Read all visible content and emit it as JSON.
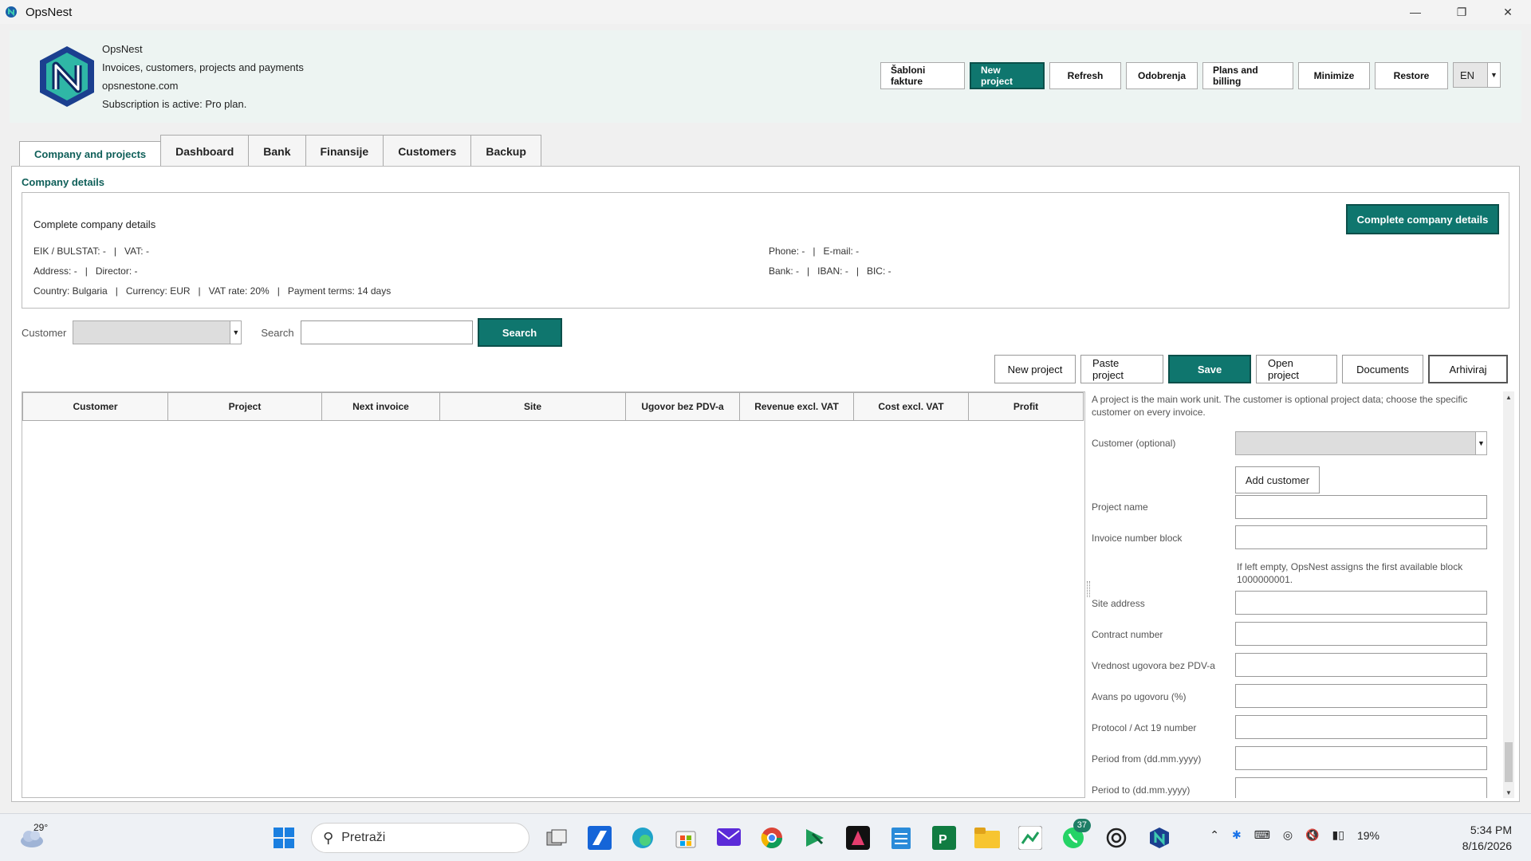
{
  "window": {
    "title": "OpsNest"
  },
  "header": {
    "app_name": "OpsNest",
    "tagline": "Invoices, customers, projects and payments",
    "website": "opsnestone.com",
    "subscription": "Subscription is active: Pro plan.",
    "buttons": [
      "Šabloni fakture",
      "New project",
      "Refresh",
      "Odobrenja",
      "Plans and billing",
      "Minimize",
      "Restore"
    ],
    "language": "EN"
  },
  "tabs": [
    "Company and projects",
    "Dashboard",
    "Bank",
    "Finansije",
    "Customers",
    "Backup"
  ],
  "company": {
    "section_title": "Company details",
    "box_label": "Complete company details",
    "complete_button": "Complete company details",
    "eik": "EIK / BULSTAT: -",
    "vat": "VAT: -",
    "address": "Address: -",
    "director": "Director: -",
    "country": "Country: Bulgaria",
    "currency": "Currency: EUR",
    "vat_rate": "VAT rate: 20%",
    "payment_terms": "Payment terms: 14 days",
    "phone": "Phone: -",
    "email": "E-mail: -",
    "bank": "Bank: -",
    "iban": "IBAN: -",
    "bic": "BIC: -"
  },
  "filter": {
    "customer_label": "Customer",
    "search_label": "Search",
    "search_button": "Search"
  },
  "actions": [
    "New project",
    "Paste project",
    "Save",
    "Open project",
    "Documents",
    "Arhiviraj"
  ],
  "table": {
    "columns": [
      "Customer",
      "Project",
      "Next invoice",
      "Site",
      "Ugovor bez PDV-a",
      "Revenue excl. VAT",
      "Cost excl. VAT",
      "Profit"
    ]
  },
  "form": {
    "intro": "A project is the main work unit. The customer is optional project data; choose the specific customer on every invoice.",
    "customer_label": "Customer (optional)",
    "add_customer": "Add customer",
    "project_name": "Project name",
    "invoice_block": "Invoice number block",
    "invoice_hint": "If left empty, OpsNest assigns the first available block 1000000001.",
    "site_address": "Site address",
    "contract_number": "Contract number",
    "contract_value": "Vrednost ugovora bez PDV-a",
    "advance": "Avans po ugovoru (%)",
    "protocol": "Protocol / Act 19 number",
    "period_from": "Period from (dd.mm.yyyy)",
    "period_to": "Period to (dd.mm.yyyy)"
  },
  "taskbar": {
    "temperature": "29°",
    "search_placeholder": "Pretraži",
    "whatsapp_badge": "37",
    "battery": "19%",
    "time": "5:34 PM",
    "date": "8/16/2026"
  },
  "colors": {
    "accent": "#0f766e",
    "accent_dark": "#0b4f4a",
    "header_bg": "#edf4f2"
  }
}
